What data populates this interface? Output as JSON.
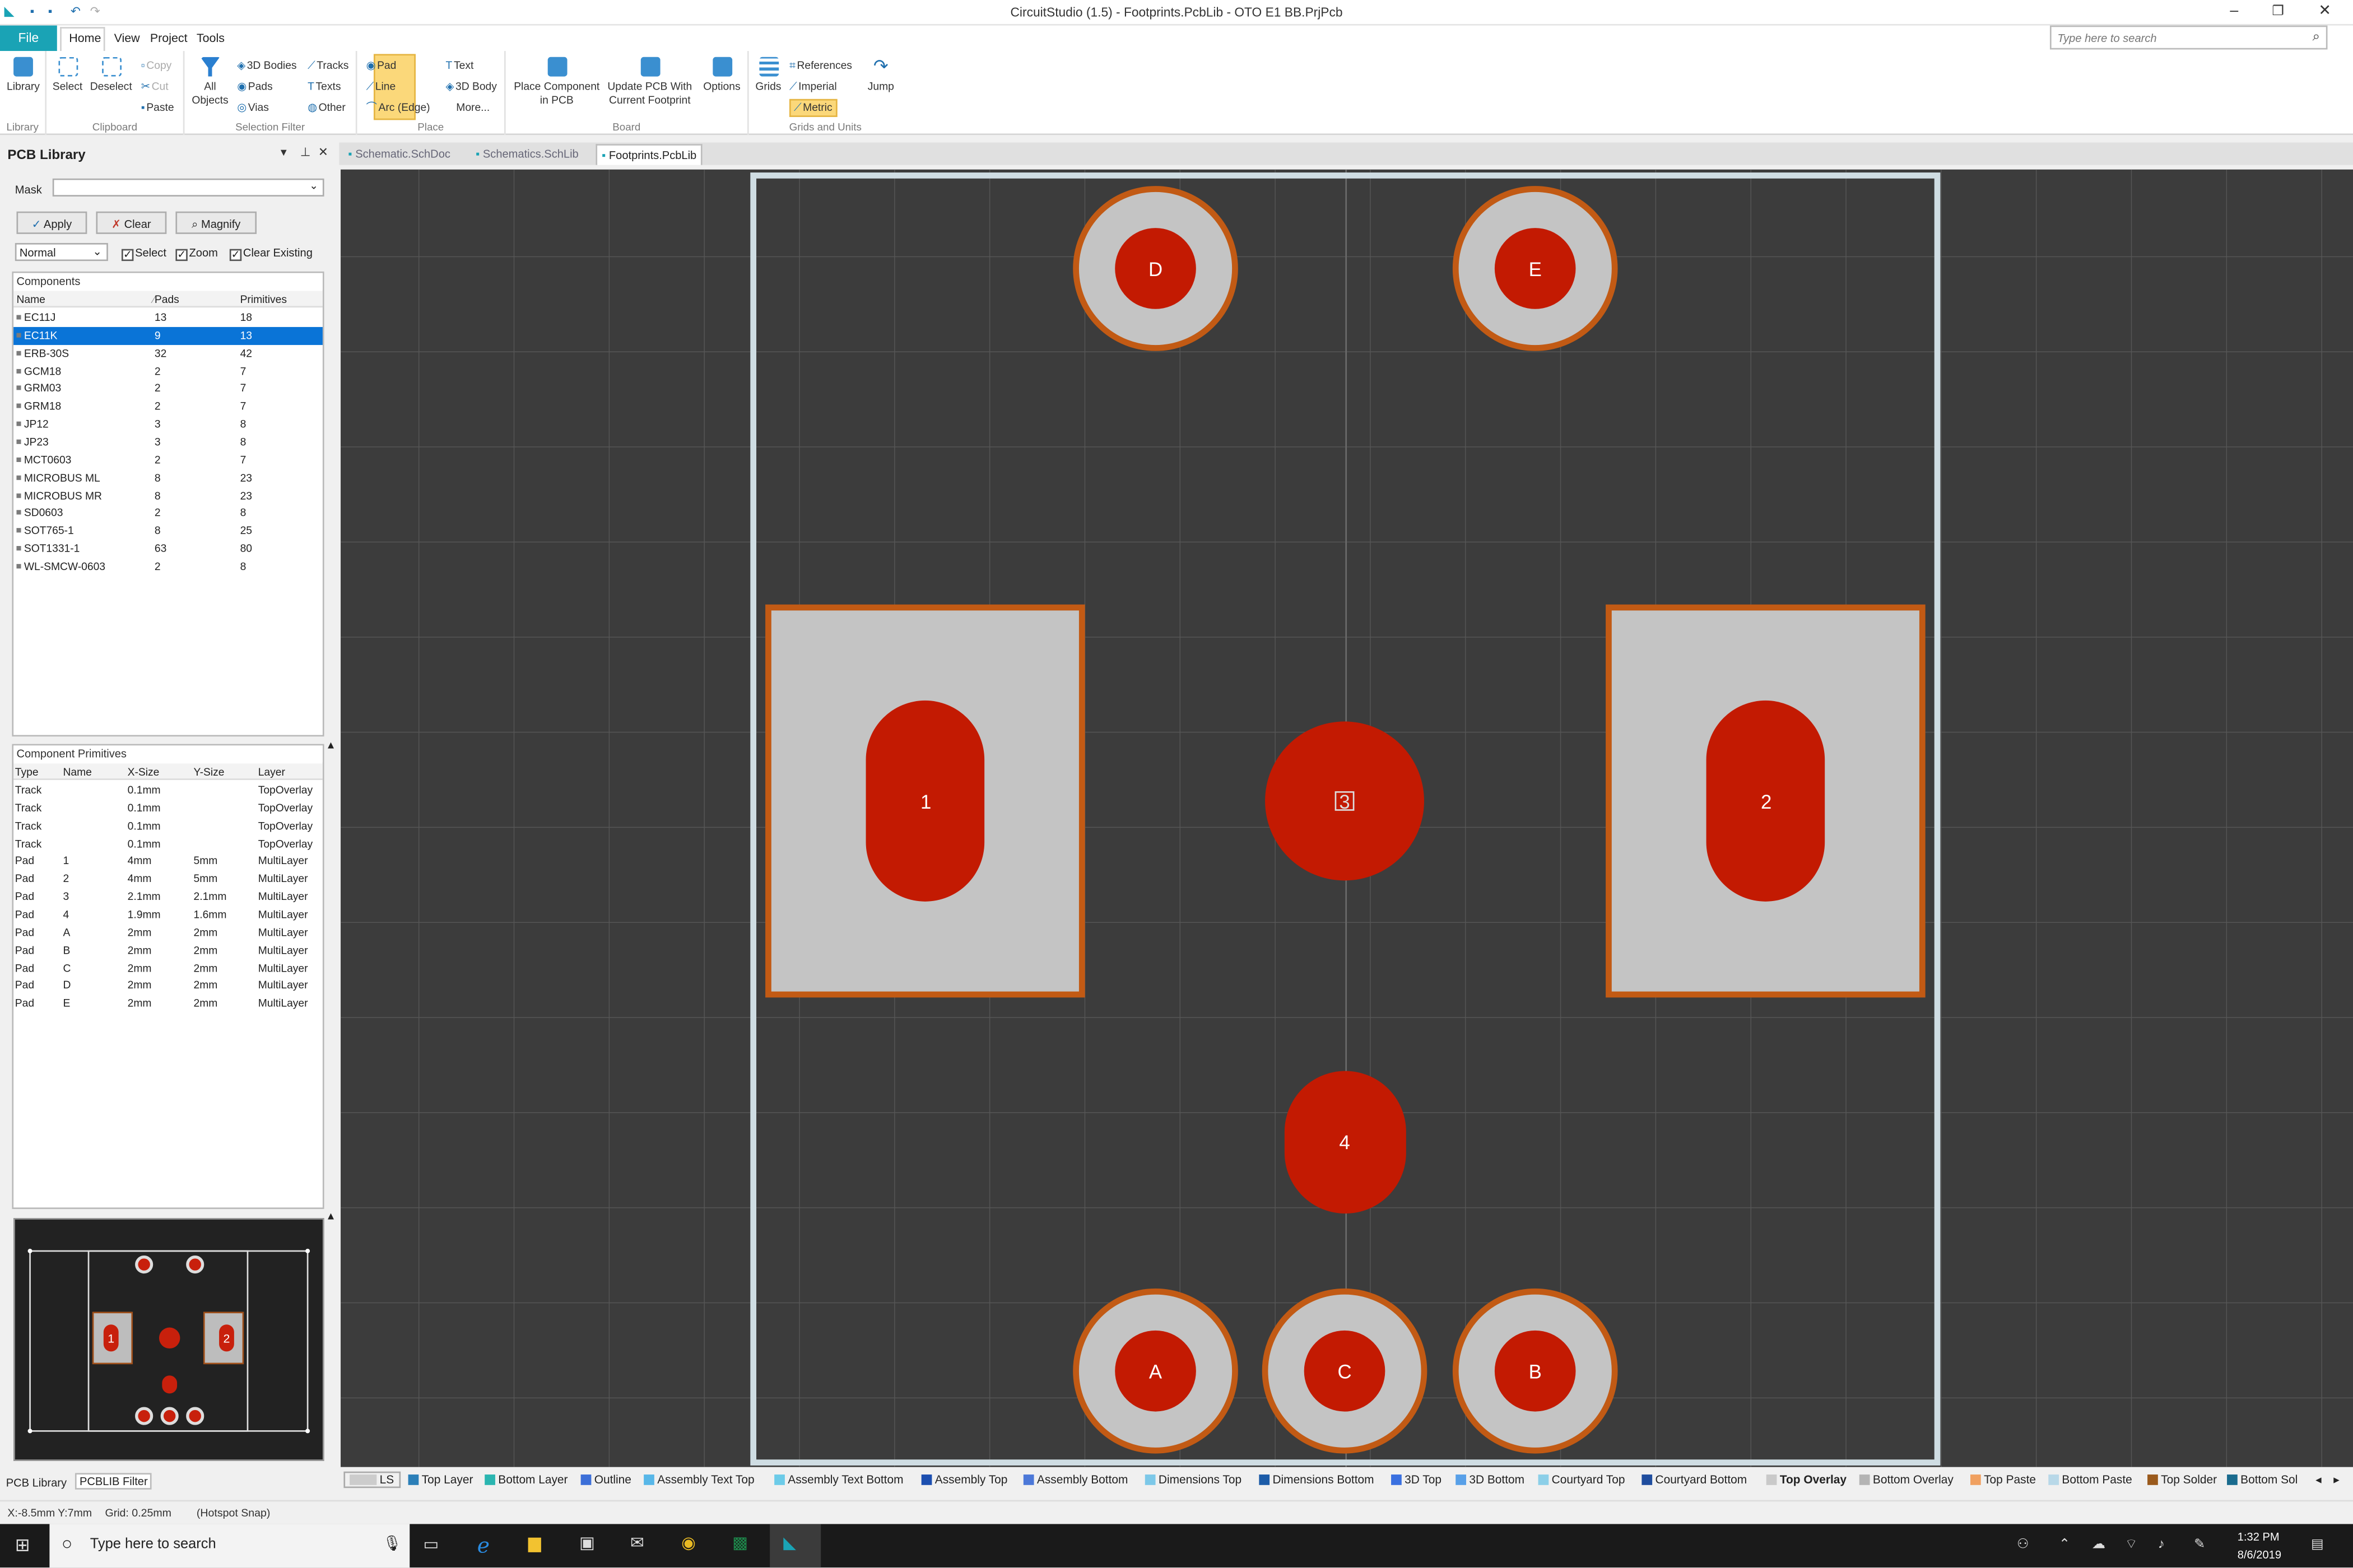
{
  "window": {
    "title": "CircuitStudio (1.5) - Footprints.PcbLib - OTO E1 BB.PrjPcb",
    "search_placeholder": "Type here to search"
  },
  "ribbon_tabs": {
    "file": "File",
    "home": "Home",
    "view": "View",
    "project": "Project",
    "tools": "Tools"
  },
  "ribbon": {
    "library": "Library",
    "select": "Select",
    "deselect": "Deselect",
    "copy": "Copy",
    "cut": "Cut",
    "paste": "Paste",
    "all_objects": "All Objects",
    "bodies3d": "3D Bodies",
    "tracks": "Tracks",
    "pads": "Pads",
    "texts": "Texts",
    "vias": "Vias",
    "other": "Other",
    "pad": "Pad",
    "line": "Line",
    "arc": "Arc (Edge)",
    "text": "Text",
    "body3d": "3D Body",
    "more": "More...",
    "place_component": "Place Component in PCB",
    "update_pcb": "Update PCB With Current Footprint",
    "options": "Options",
    "grids": "Grids",
    "references": "References",
    "imperial": "Imperial",
    "metric": "Metric",
    "jump": "Jump",
    "groups": {
      "library": "Library",
      "clipboard": "Clipboard",
      "selection_filter": "Selection Filter",
      "place": "Place",
      "board": "Board",
      "grids_units": "Grids and Units"
    }
  },
  "panel": {
    "title": "PCB Library",
    "mask_label": "Mask",
    "apply": "Apply",
    "clear": "Clear",
    "magnify": "Magnify",
    "mode": "Normal",
    "select": "Select",
    "zoom": "Zoom",
    "clear_existing": "Clear Existing",
    "components_caption": "Components",
    "components_headers": [
      "Name",
      "Pads",
      "Primitives"
    ],
    "components": [
      [
        "EC11J",
        "13",
        "18"
      ],
      [
        "EC11K",
        "9",
        "13"
      ],
      [
        "ERB-30S",
        "32",
        "42"
      ],
      [
        "GCM18",
        "2",
        "7"
      ],
      [
        "GRM03",
        "2",
        "7"
      ],
      [
        "GRM18",
        "2",
        "7"
      ],
      [
        "JP12",
        "3",
        "8"
      ],
      [
        "JP23",
        "3",
        "8"
      ],
      [
        "MCT0603",
        "2",
        "7"
      ],
      [
        "MICROBUS ML",
        "8",
        "23"
      ],
      [
        "MICROBUS MR",
        "8",
        "23"
      ],
      [
        "SD0603",
        "2",
        "8"
      ],
      [
        "SOT765-1",
        "8",
        "25"
      ],
      [
        "SOT1331-1",
        "63",
        "80"
      ],
      [
        "WL-SMCW-0603",
        "2",
        "8"
      ]
    ],
    "selected_index": 1,
    "primitives_caption": "Component Primitives",
    "primitives_headers": [
      "Type",
      "Name",
      "X-Size",
      "Y-Size",
      "Layer"
    ],
    "primitives": [
      [
        "Track",
        "",
        "0.1mm",
        "",
        "TopOverlay"
      ],
      [
        "Track",
        "",
        "0.1mm",
        "",
        "TopOverlay"
      ],
      [
        "Track",
        "",
        "0.1mm",
        "",
        "TopOverlay"
      ],
      [
        "Track",
        "",
        "0.1mm",
        "",
        "TopOverlay"
      ],
      [
        "Pad",
        "1",
        "4mm",
        "5mm",
        "MultiLayer"
      ],
      [
        "Pad",
        "2",
        "4mm",
        "5mm",
        "MultiLayer"
      ],
      [
        "Pad",
        "3",
        "2.1mm",
        "2.1mm",
        "MultiLayer"
      ],
      [
        "Pad",
        "4",
        "1.9mm",
        "1.6mm",
        "MultiLayer"
      ],
      [
        "Pad",
        "A",
        "2mm",
        "2mm",
        "MultiLayer"
      ],
      [
        "Pad",
        "B",
        "2mm",
        "2mm",
        "MultiLayer"
      ],
      [
        "Pad",
        "C",
        "2mm",
        "2mm",
        "MultiLayer"
      ],
      [
        "Pad",
        "D",
        "2mm",
        "2mm",
        "MultiLayer"
      ],
      [
        "Pad",
        "E",
        "2mm",
        "2mm",
        "MultiLayer"
      ]
    ],
    "tab_pcb_library": "PCB Library",
    "tab_filter": "PCBLIB Filter"
  },
  "doc_tabs": [
    "Schematic.SchDoc",
    "Schematics.SchLib",
    "Footprints.PcbLib"
  ],
  "pads": {
    "p1": "1",
    "p2": "2",
    "p3": "3",
    "p4": "4",
    "pA": "A",
    "pB": "B",
    "pC": "C",
    "pD": "D",
    "pE": "E"
  },
  "layers": {
    "ls": "LS",
    "items": [
      {
        "name": "Top Layer",
        "color": "#2b7fb8"
      },
      {
        "name": "Bottom Layer",
        "color": "#2ab5b0"
      },
      {
        "name": "Outline",
        "color": "#3c6fd8"
      },
      {
        "name": "Assembly Text Top",
        "color": "#58b7e8"
      },
      {
        "name": "Assembly Text Bottom",
        "color": "#6ccbe8"
      },
      {
        "name": "Assembly Top",
        "color": "#1c4fb0"
      },
      {
        "name": "Assembly Bottom",
        "color": "#4c78d8"
      },
      {
        "name": "Dimensions Top",
        "color": "#7cc8e8"
      },
      {
        "name": "Dimensions Bottom",
        "color": "#1c5ca8"
      },
      {
        "name": "3D Top",
        "color": "#3a70e0"
      },
      {
        "name": "3D Bottom",
        "color": "#58a0e8"
      },
      {
        "name": "Courtyard Top",
        "color": "#8ccfe8"
      },
      {
        "name": "Courtyard Bottom",
        "color": "#1f4d9e"
      },
      {
        "name": "Top Overlay",
        "color": "#c9c9c9"
      },
      {
        "name": "Bottom Overlay",
        "color": "#b4b4b4"
      },
      {
        "name": "Top Paste",
        "color": "#f0a060"
      },
      {
        "name": "Bottom Paste",
        "color": "#b8d8e8"
      },
      {
        "name": "Top Solder",
        "color": "#9a5a1c"
      },
      {
        "name": "Bottom Sol",
        "color": "#1a6b8e"
      }
    ]
  },
  "status": {
    "coords": "X:-8.5mm Y:7mm",
    "grid": "Grid: 0.25mm",
    "snap": "(Hotspot Snap)"
  },
  "taskbar": {
    "search": "Type here to search",
    "time": "1:32 PM",
    "date": "8/6/2019"
  }
}
